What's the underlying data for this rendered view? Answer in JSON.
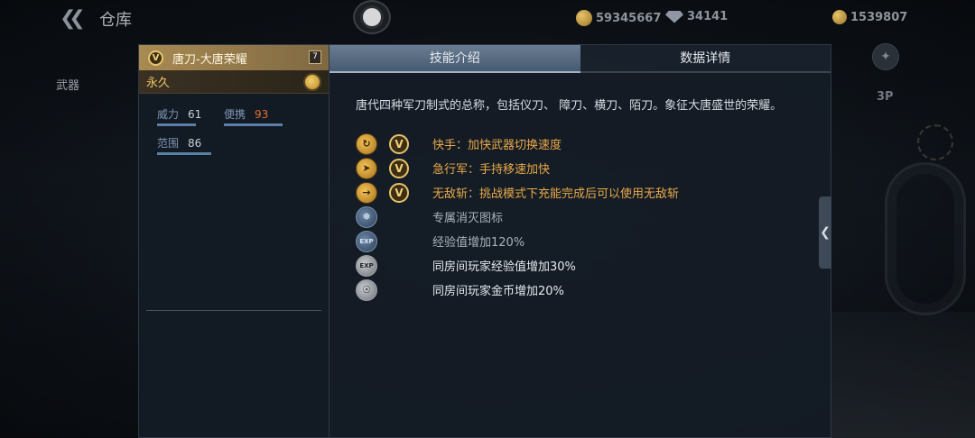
{
  "topbar": {
    "title": "仓库",
    "currencies": [
      {
        "icon": "gold-coin-icon",
        "amount": "59345667"
      },
      {
        "icon": "diamond-icon",
        "amount": "34141"
      },
      {
        "icon": "honor-coin-icon",
        "amount": "1539807"
      }
    ]
  },
  "sidebar": {
    "tab_label": "武器"
  },
  "right_side": {
    "view_label": "3P"
  },
  "weapon": {
    "name": "唐刀-大唐荣耀",
    "badge": "V",
    "level": "7",
    "duration": "永久",
    "stats": [
      {
        "label": "威力",
        "value": "61",
        "level": 0.61
      },
      {
        "label": "便携",
        "value": "93",
        "level": 0.93
      },
      {
        "label": "范围",
        "value": "86",
        "level": 0.86
      }
    ]
  },
  "tabs": [
    {
      "label": "技能介绍",
      "active": true
    },
    {
      "label": "数据详情",
      "active": false
    }
  ],
  "description": "唐代四种军刀制式的总称，包括仪刀、 障刀、横刀、陌刀。象征大唐盛世的荣耀。",
  "perks": [
    {
      "icon": "quick-hands-icon",
      "vip": true,
      "text": "快手：加快武器切换速度",
      "style": "gold"
    },
    {
      "icon": "sprint-icon",
      "vip": true,
      "text": "急行军：手持移速加快",
      "style": "gold"
    },
    {
      "icon": "invincible-slash-icon",
      "vip": true,
      "text": "无敌斩：挑战模式下充能完成后可以使用无敌斩",
      "style": "gold"
    },
    {
      "icon": "kill-icon",
      "vip": false,
      "text": "专属消灭图标",
      "style": "muted"
    },
    {
      "icon": "exp-icon",
      "vip": false,
      "text": "经验值增加120%",
      "style": "muted"
    },
    {
      "icon": "room-exp-icon",
      "vip": false,
      "text": "同房间玩家经验值增加30%",
      "style": "white"
    },
    {
      "icon": "room-gold-icon",
      "vip": false,
      "text": "同房间玩家金币增加20%",
      "style": "white"
    }
  ],
  "vip_badge": "V",
  "icon_glyphs": {
    "exp": "EXP"
  }
}
